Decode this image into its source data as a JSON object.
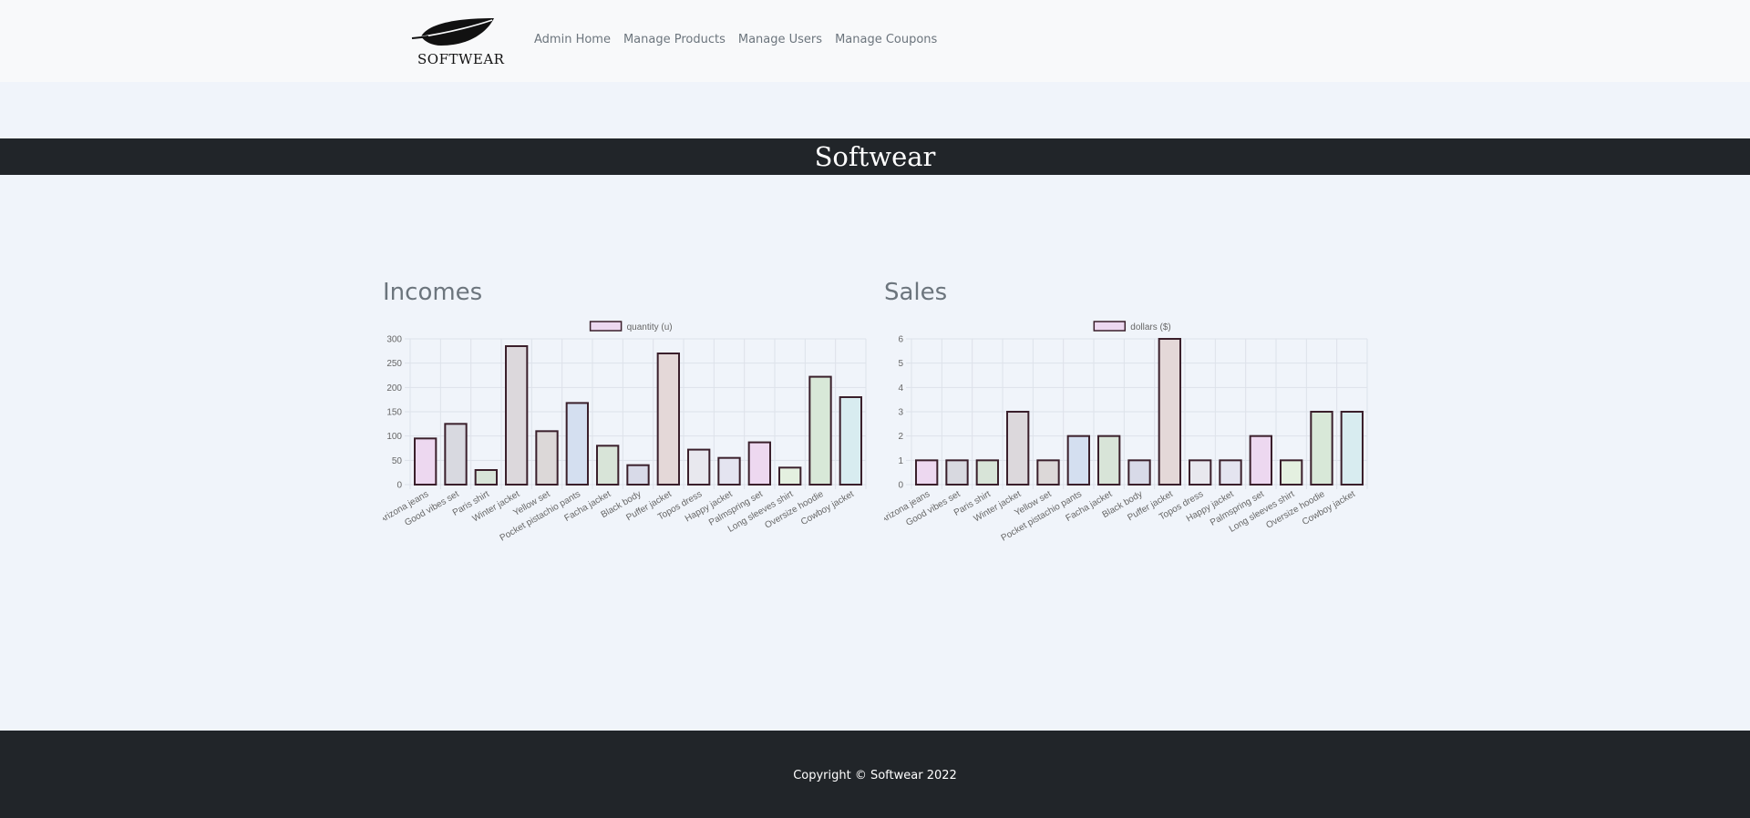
{
  "brand": {
    "logo_text": "SOFTWEAR"
  },
  "nav": {
    "links": [
      "Admin Home",
      "Manage Products",
      "Manage Users",
      "Manage Coupons"
    ]
  },
  "banner": {
    "title": "Softwear"
  },
  "sections": {
    "incomes_title": "Incomes",
    "sales_title": "Sales"
  },
  "footer": {
    "copyright": "Copyright © Softwear 2022"
  },
  "chart_data": [
    {
      "type": "bar",
      "series_label": "quantity (u)",
      "categories": [
        "Arizona jeans",
        "Good vibes set",
        "Paris shirt",
        "Winter jacket",
        "Yellow set",
        "Pocket pistachio pants",
        "Facha jacket",
        "Black body",
        "Puffer jacket",
        "Topos dress",
        "Happy jacket",
        "Palmspring set",
        "Long sleeves shirt",
        "Oversize hoodie",
        "Cowboy jacket"
      ],
      "values": [
        95,
        125,
        30,
        285,
        110,
        168,
        80,
        40,
        270,
        72,
        55,
        87,
        35,
        222,
        180
      ],
      "ylim": [
        0,
        300
      ],
      "yticks": [
        0,
        50,
        100,
        150,
        200,
        250,
        300
      ],
      "legend_position": "top",
      "grid": true
    },
    {
      "type": "bar",
      "series_label": "dollars ($)",
      "categories": [
        "Arizona jeans",
        "Good vibes set",
        "Paris shirt",
        "Winter jacket",
        "Yellow set",
        "Pocket pistachio pants",
        "Facha jacket",
        "Black body",
        "Puffer jacket",
        "Topos dress",
        "Happy jacket",
        "Palmspring set",
        "Long sleeves shirt",
        "Oversize hoodie",
        "Cowboy jacket"
      ],
      "values": [
        1,
        1,
        1,
        3,
        1,
        2,
        2,
        1,
        6,
        1,
        1,
        2,
        1,
        3,
        3
      ],
      "ylim": [
        0,
        6
      ],
      "yticks": [
        0,
        1,
        2,
        3,
        4,
        5,
        6
      ],
      "legend_position": "top",
      "grid": true
    }
  ],
  "colors": {
    "bar_fills": [
      "#edd8f0",
      "#d8d9e0",
      "#d8e4d8",
      "#dcd8dc",
      "#dcd8d8",
      "#d4dff0",
      "#d8e4d8",
      "#d8dae8",
      "#e4d8d8",
      "#e8e8ee",
      "#e4e4f0",
      "#edd8f0",
      "#e4f0e0",
      "#d8e8d8",
      "#d8ecf0"
    ],
    "bar_border": "#3a1f2b",
    "legend_fill": "#edd8f0"
  }
}
